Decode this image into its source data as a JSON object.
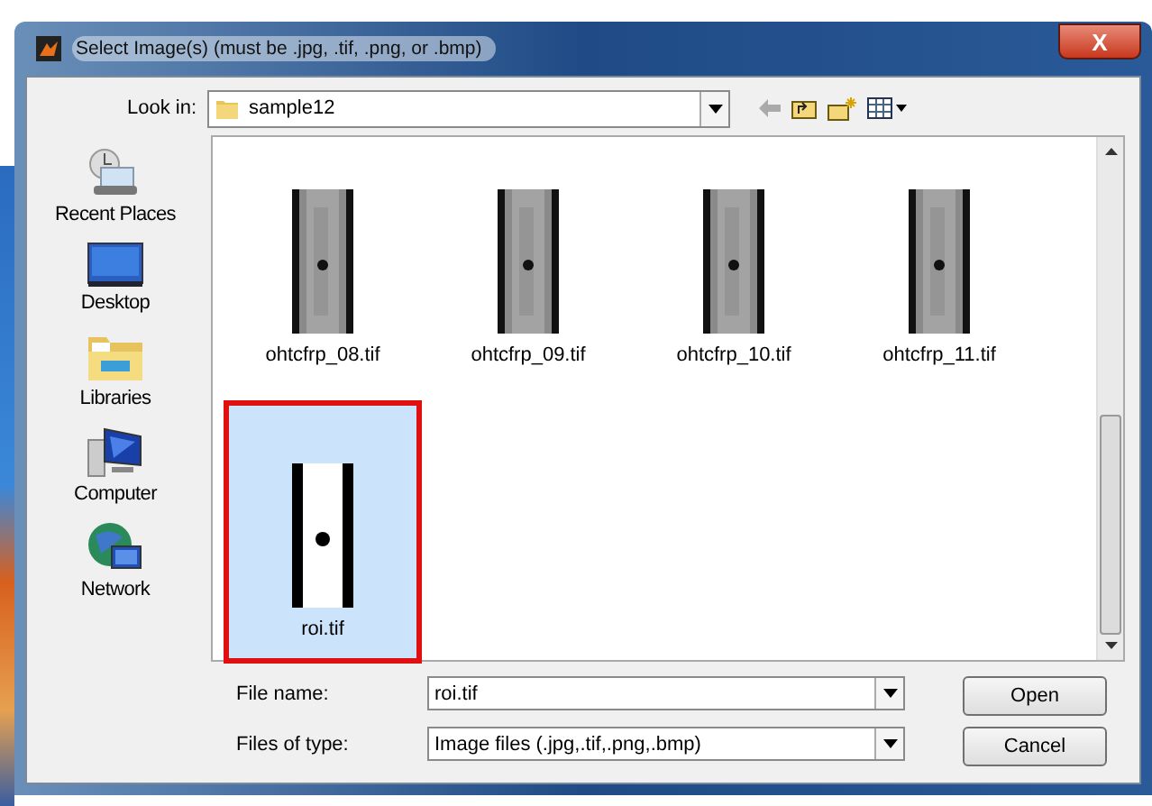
{
  "window": {
    "title": "Select Image(s) (must be .jpg, .tif, .png, or .bmp)",
    "close": "X"
  },
  "look_in": {
    "label": "Look in:",
    "value": "sample12"
  },
  "places": [
    {
      "label": "Recent Places",
      "kind": "recent"
    },
    {
      "label": "Desktop",
      "kind": "desktop"
    },
    {
      "label": "Libraries",
      "kind": "libraries"
    },
    {
      "label": "Computer",
      "kind": "computer"
    },
    {
      "label": "Network",
      "kind": "network"
    }
  ],
  "files": [
    {
      "name": "ohtcfrp_08.tif",
      "kind": "textured",
      "selected": false,
      "annotated": false
    },
    {
      "name": "ohtcfrp_09.tif",
      "kind": "textured",
      "selected": false,
      "annotated": false
    },
    {
      "name": "ohtcfrp_10.tif",
      "kind": "textured",
      "selected": false,
      "annotated": false
    },
    {
      "name": "ohtcfrp_11.tif",
      "kind": "textured",
      "selected": false,
      "annotated": false
    },
    {
      "name": "roi.tif",
      "kind": "plain",
      "selected": true,
      "annotated": true
    }
  ],
  "file_name": {
    "label": "File name:",
    "value": "roi.tif"
  },
  "file_type": {
    "label": "Files of type:",
    "value": "Image files (.jpg,.tif,.png,.bmp)"
  },
  "buttons": [
    "Open",
    "Cancel"
  ]
}
